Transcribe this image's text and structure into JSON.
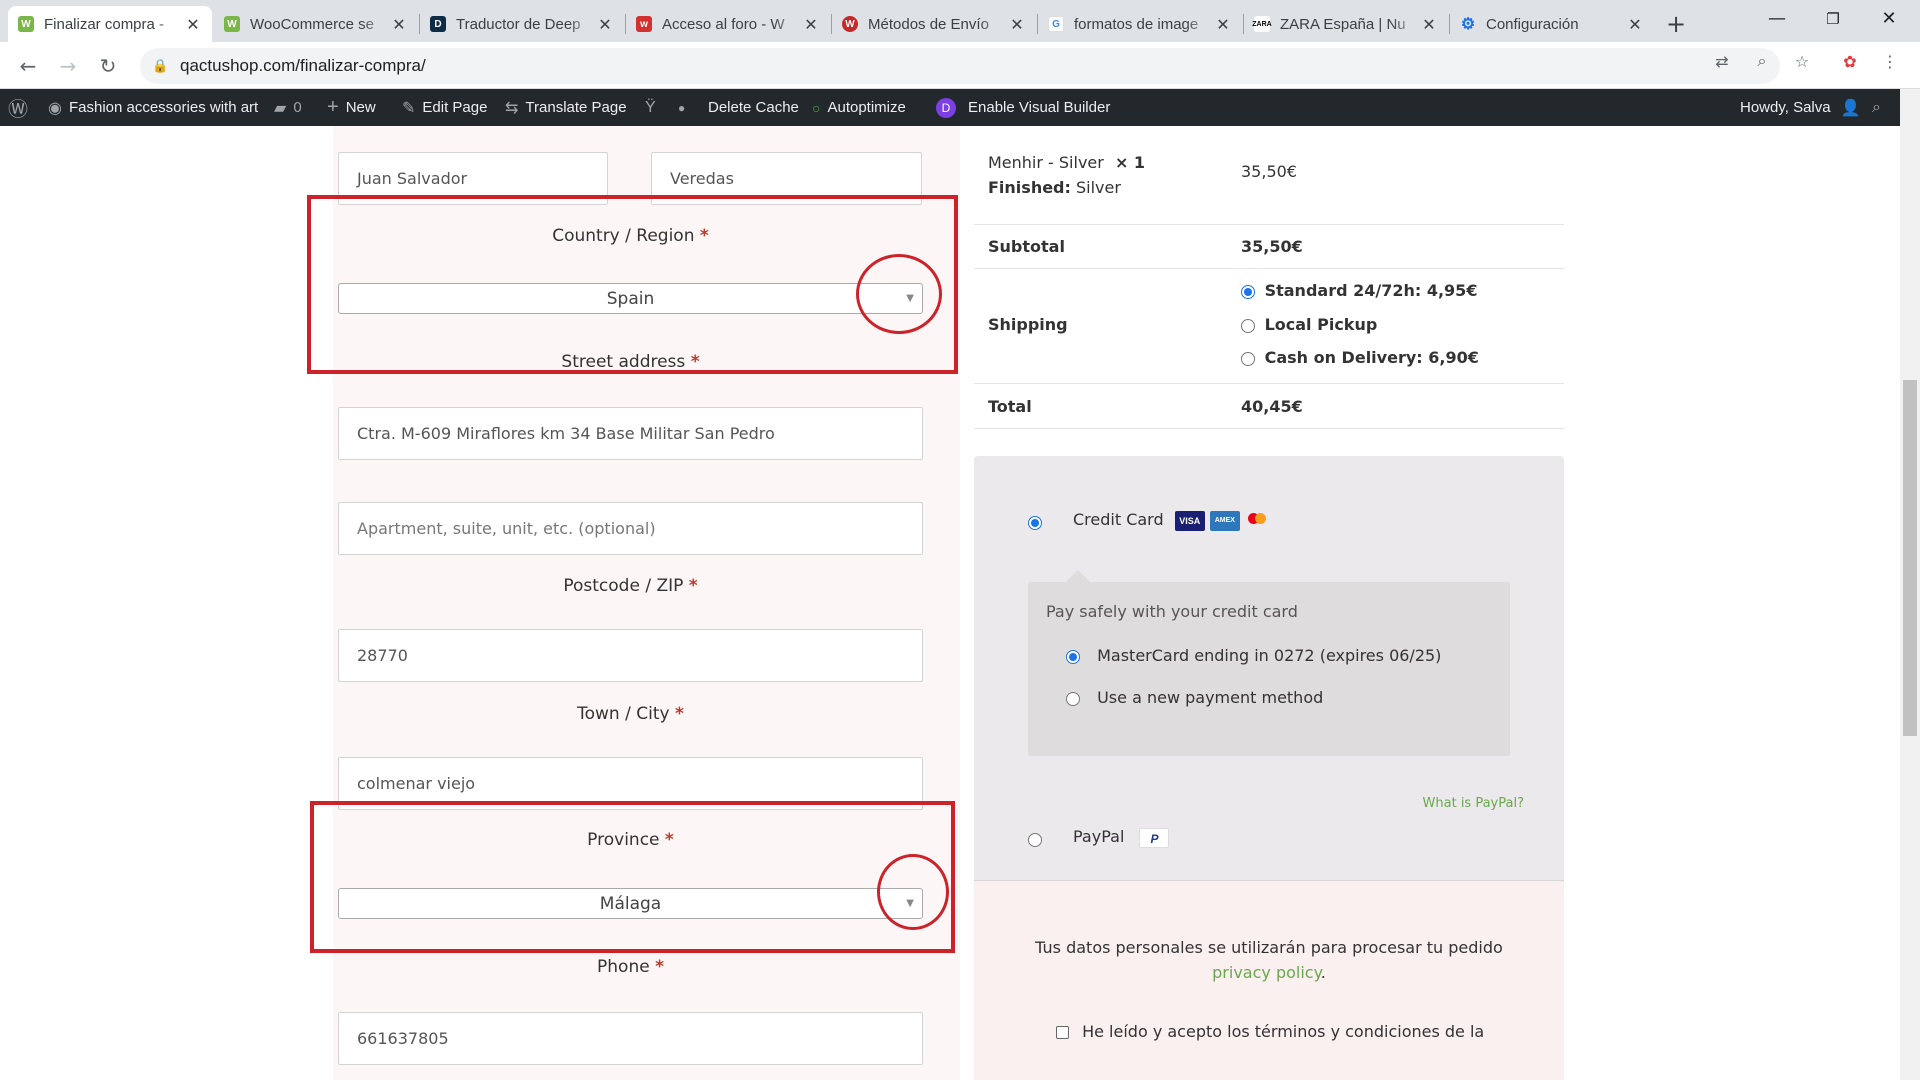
{
  "browser": {
    "tabs": [
      {
        "title": "Finalizar compra -",
        "favicon_color": "#7ab648",
        "favicon": "woo-icon",
        "active": true
      },
      {
        "title": "WooCommerce se",
        "favicon_color": "#7ab648",
        "favicon": "woo-icon",
        "active": false
      },
      {
        "title": "Traductor de Deep",
        "favicon_color": "#0f2b46",
        "favicon": "deepl-icon",
        "active": false
      },
      {
        "title": "Acceso al foro - W",
        "favicon_color": "#d32f2f",
        "favicon": "forum-icon",
        "active": false
      },
      {
        "title": "Métodos de Envío",
        "favicon_color": "#c62828",
        "favicon": "site-icon",
        "active": false
      },
      {
        "title": "formatos de image",
        "favicon_color": "#4285f4",
        "favicon": "google-icon",
        "active": false
      },
      {
        "title": "ZARA España | Nu",
        "favicon_color": "#000000",
        "favicon": "zara-icon",
        "active": false
      },
      {
        "title": "Configuración",
        "favicon_color": "#1a73e8",
        "favicon": "settings-icon",
        "active": false
      }
    ],
    "new_tab": "+",
    "url": "qactushop.com/finalizar-compra/"
  },
  "wp_admin_bar": {
    "site_name": "Fashion accessories with art",
    "comments_count": "0",
    "new_label": "New",
    "edit_page": "Edit Page",
    "translate_page": "Translate Page",
    "delete_cache": "Delete Cache",
    "autoptimize": "Autoptimize",
    "visual_builder": "Enable Visual Builder",
    "howdy": "Howdy, Salva"
  },
  "billing": {
    "first_name": "Juan Salvador",
    "last_name": "Veredas",
    "country_label": "Country / Region",
    "country_value": "Spain",
    "street_label": "Street address",
    "street_value": "Ctra. M-609 Miraflores km 34 Base Militar San Pedro",
    "apartment_placeholder": "Apartment, suite, unit, etc. (optional)",
    "postcode_label": "Postcode / ZIP",
    "postcode_value": "28770",
    "city_label": "Town / City",
    "city_value": "colmenar viejo",
    "province_label": "Province",
    "province_value": "Málaga",
    "phone_label": "Phone",
    "phone_value": "661637805",
    "required_mark": "*"
  },
  "order": {
    "item_name": "Menhir - Silver",
    "item_qty": "× 1",
    "finished_label": "Finished:",
    "finished_value": "Silver",
    "item_price": "35,50€",
    "subtotal_label": "Subtotal",
    "subtotal_value": "35,50€",
    "shipping_label": "Shipping",
    "shipping_options": [
      {
        "label": "Standard 24/72h: 4,95€",
        "selected": true
      },
      {
        "label": "Local Pickup",
        "selected": false
      },
      {
        "label": "Cash on Delivery: 6,90€",
        "selected": false
      }
    ],
    "total_label": "Total",
    "total_value": "40,45€"
  },
  "payment": {
    "credit_card_label": "Credit Card",
    "card_logos": [
      "VISA",
      "AMEX",
      "MC"
    ],
    "pay_safely": "Pay safely with your credit card",
    "saved_card": "MasterCard ending in 0272 (expires 06/25)",
    "new_method": "Use a new payment method",
    "what_is_paypal": "What is PayPal?",
    "paypal_label": "PayPal",
    "paypal_logo": "P"
  },
  "privacy": {
    "text": "Tus datos personales se utilizarán para procesar tu pedido",
    "link": "privacy policy",
    "terms": "He leído y acepto los términos y condiciones de la"
  },
  "colors": {
    "annotation_red": "#cc2229",
    "wp_bar": "#23282d",
    "link_green": "#6aa84f",
    "required": "#c0392b"
  }
}
